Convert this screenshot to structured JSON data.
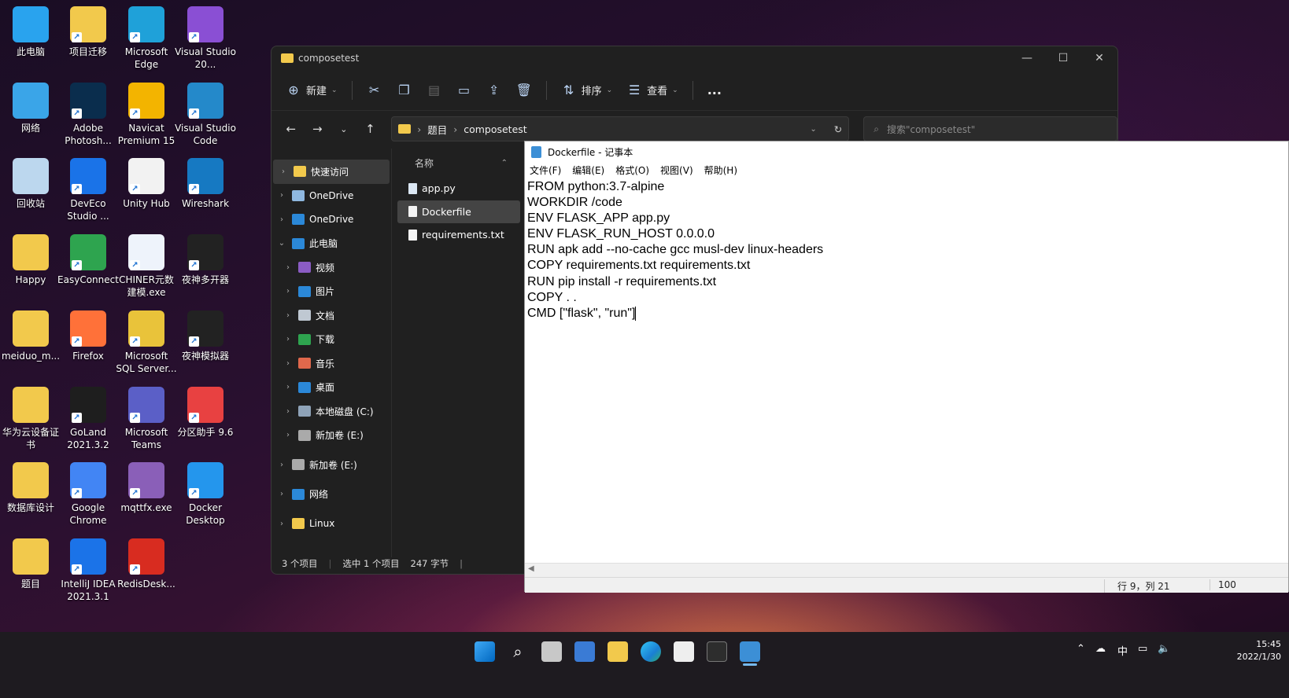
{
  "desktop": {
    "icons": [
      {
        "label": "此电脑",
        "color": "#29a3ee"
      },
      {
        "label": "项目迁移",
        "color": "#f2c94c"
      },
      {
        "label": "Microsoft Edge",
        "color": "#1fa1d9"
      },
      {
        "label": "Visual Studio 20...",
        "color": "#8a4fd4"
      },
      {
        "label": "网络",
        "color": "#3aa5e8"
      },
      {
        "label": "Adobe Photosh...",
        "color": "#0a2d4d"
      },
      {
        "label": "Navicat Premium 15",
        "color": "#f3b400"
      },
      {
        "label": "Visual Studio Code",
        "color": "#2489ca"
      },
      {
        "label": "回收站",
        "color": "#bcd7ee"
      },
      {
        "label": "DevEco Studio ...",
        "color": "#1a73e8"
      },
      {
        "label": "Unity Hub",
        "color": "#f2f2f2"
      },
      {
        "label": "Wireshark",
        "color": "#1679c2"
      },
      {
        "label": "Happy",
        "color": "#f2c94c"
      },
      {
        "label": "EasyConnect",
        "color": "#2ea44f"
      },
      {
        "label": "CHINER元数建模.exe",
        "color": "#eef3fb"
      },
      {
        "label": "夜神多开器",
        "color": "#222"
      },
      {
        "label": "meiduo_m...",
        "color": "#f2c94c"
      },
      {
        "label": "Firefox",
        "color": "#ff7139"
      },
      {
        "label": "Microsoft SQL Server...",
        "color": "#e9c33a"
      },
      {
        "label": "夜神模拟器",
        "color": "#222"
      },
      {
        "label": "华为云设备证书",
        "color": "#f2c94c"
      },
      {
        "label": "GoLand 2021.3.2",
        "color": "#1e1e1e"
      },
      {
        "label": "Microsoft Teams",
        "color": "#5b5fc7"
      },
      {
        "label": "分区助手 9.6",
        "color": "#e84141"
      },
      {
        "label": "数据库设计",
        "color": "#f2c94c"
      },
      {
        "label": "Google Chrome",
        "color": "#4285f4"
      },
      {
        "label": "mqttfx.exe",
        "color": "#8a5fb8"
      },
      {
        "label": "Docker Desktop",
        "color": "#2496ed"
      },
      {
        "label": "题目",
        "color": "#f2c94c"
      },
      {
        "label": "IntelliJ IDEA 2021.3.1",
        "color": "#1b73e8"
      },
      {
        "label": "RedisDesk...",
        "color": "#d82c20"
      }
    ]
  },
  "explorer": {
    "title": "composetest",
    "toolbar": {
      "new": "新建",
      "sort": "排序",
      "view": "查看",
      "more": "..."
    },
    "breadcrumb": [
      "题目",
      "composetest"
    ],
    "search_placeholder": "搜索\"composetest\"",
    "nav": [
      {
        "label": "快速访问",
        "color": "#f2c94c",
        "selected": true
      },
      {
        "label": "OneDrive",
        "color": "#8fb8e0"
      },
      {
        "label": "OneDrive",
        "color": "#2b88d8"
      },
      {
        "label": "此电脑",
        "color": "#2b88d8",
        "expanded": true
      },
      {
        "label": "视频",
        "color": "#8b5cc4"
      },
      {
        "label": "图片",
        "color": "#2b88d8"
      },
      {
        "label": "文档",
        "color": "#bfc8d2"
      },
      {
        "label": "下载",
        "color": "#2ea44f"
      },
      {
        "label": "音乐",
        "color": "#e0684c"
      },
      {
        "label": "桌面",
        "color": "#2b88d8"
      },
      {
        "label": "本地磁盘 (C:)",
        "color": "#8fa3b8"
      },
      {
        "label": "新加卷 (E:)",
        "color": "#aaaaaa"
      },
      {
        "label": "新加卷 (E:)",
        "color": "#aaaaaa"
      },
      {
        "label": "网络",
        "color": "#2b88d8"
      },
      {
        "label": "Linux",
        "color": "#f2c94c"
      }
    ],
    "column_name": "名称",
    "files": [
      {
        "name": "app.py"
      },
      {
        "name": "Dockerfile",
        "selected": true
      },
      {
        "name": "requirements.txt"
      }
    ],
    "status": {
      "count": "3 个项目",
      "selection": "选中 1 个项目",
      "size": "247 字节"
    }
  },
  "notepad": {
    "title": "Dockerfile - 记事本",
    "menu": [
      "文件(F)",
      "编辑(E)",
      "格式(O)",
      "视图(V)",
      "帮助(H)"
    ],
    "lines": [
      "FROM python:3.7-alpine",
      "WORKDIR /code",
      "ENV FLASK_APP app.py",
      "ENV FLASK_RUN_HOST 0.0.0.0",
      "RUN apk add --no-cache gcc musl-dev linux-headers",
      "COPY requirements.txt requirements.txt",
      "RUN pip install -r requirements.txt",
      "COPY . .",
      "CMD [\"flask\", \"run\"]"
    ],
    "status_position": "行 9，列 21",
    "status_zoom": "100"
  },
  "taskbar": {
    "time": "15:45",
    "date": "2022/1/30",
    "ime": "中"
  }
}
